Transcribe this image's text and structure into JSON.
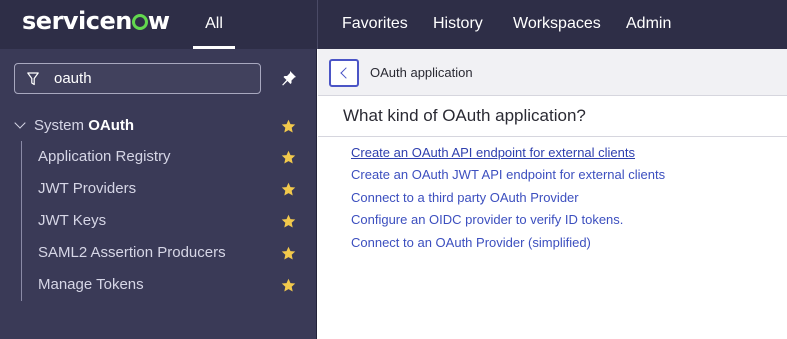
{
  "header": {
    "logo_text": [
      "service",
      "n",
      "w"
    ],
    "all_tab": "All",
    "nav": [
      "Favorites",
      "History",
      "Workspaces",
      "Admin"
    ]
  },
  "sidebar": {
    "filter_value": "oauth",
    "group": {
      "prefix": "System ",
      "bold": "OAuth"
    },
    "items": [
      {
        "label": "Application Registry"
      },
      {
        "label": "JWT Providers"
      },
      {
        "label": "JWT Keys"
      },
      {
        "label": "SAML2 Assertion Producers"
      },
      {
        "label": "Manage Tokens"
      }
    ]
  },
  "content": {
    "title": "OAuth application",
    "question": "What kind of OAuth application?",
    "links": [
      "Create an OAuth API endpoint for external clients",
      "Create an OAuth JWT API endpoint for external clients",
      "Connect to a third party OAuth Provider",
      "Configure an OIDC provider to verify ID tokens.",
      "Connect to an OAuth Provider (simplified)"
    ]
  },
  "colors": {
    "header_bg": "#2e2e47",
    "sidebar_bg": "#3a3a57",
    "logo_accent": "#62d84e",
    "star": "#f2c94c",
    "link": "#3c4fbf",
    "focus": "#4b55c6"
  },
  "icons": {
    "filter": "filter-icon",
    "pin": "pin-icon",
    "chevron": "chevron-down-icon",
    "star": "star-icon",
    "back": "chevron-left-icon"
  }
}
